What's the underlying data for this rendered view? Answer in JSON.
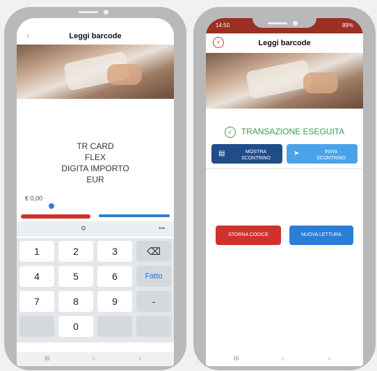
{
  "left": {
    "header_title": "Leggi barcode",
    "back_icon": "‹",
    "card_lines": [
      "TR CARD",
      "FLEX",
      "DIGITA IMPORTO",
      "EUR"
    ],
    "amount_value": "€ 0,00",
    "tools": {
      "gear": "⚙",
      "more": "•••"
    },
    "keys": [
      "1",
      "2",
      "3",
      "4",
      "5",
      "6",
      "7",
      "8",
      "9",
      "0"
    ],
    "backspace_icon": "⌫",
    "done_label": "Fatto",
    "minus_label": "-",
    "navbar": {
      "recent": "III",
      "home": "○",
      "back": "‹"
    }
  },
  "right": {
    "status_time": "14:50",
    "status_battery": "89%",
    "header_title": "Leggi barcode",
    "back_icon": "‹",
    "success_icon": "✓",
    "success_text": "TRANSAZIONE ESEGUITA",
    "show_receipt_label": "MOSTRA SCONTRINO",
    "receipt_icon": "▤",
    "send_receipt_label": "INVIA SCONTRINO",
    "send_icon": "➤",
    "storno_label": "STORNA CODICE",
    "new_read_label": "NUOVA LETTURA",
    "navbar": {
      "recent": "III",
      "home": "○",
      "back": "‹"
    }
  },
  "colors": {
    "red": "#d0312d",
    "blue": "#2a7ed8",
    "navy": "#1f4d8a",
    "lightblue": "#4aa3e8",
    "green": "#3b9a56"
  }
}
